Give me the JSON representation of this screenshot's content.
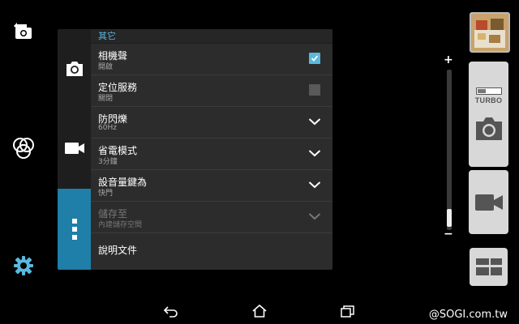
{
  "left_rail": {
    "icons": [
      "switch-camera-icon",
      "effects-icon",
      "settings-icon"
    ]
  },
  "panel": {
    "section_header": "其它",
    "tabs": [
      "camera-tab-icon",
      "video-tab-icon",
      "more-tab-icon"
    ],
    "rows": [
      {
        "title": "相機聲",
        "subtitle": "開啟",
        "control": "checkbox-checked"
      },
      {
        "title": "定位服務",
        "subtitle": "關閉",
        "control": "checkbox-unchecked"
      },
      {
        "title": "防閃爍",
        "subtitle": "60Hz",
        "control": "chevron-down"
      },
      {
        "title": "省電模式",
        "subtitle": "3分鐘",
        "control": "chevron-down"
      },
      {
        "title": "設音量鍵為",
        "subtitle": "快門",
        "control": "chevron-down"
      },
      {
        "title": "儲存至",
        "subtitle": "內建儲存空間",
        "control": "chevron-down",
        "disabled": true
      },
      {
        "title": "說明文件"
      }
    ]
  },
  "zoom": {
    "plus": "+",
    "minus": "−",
    "level": 0.05
  },
  "right_controls": {
    "turbo_label": "TURBO",
    "buttons": [
      "gallery-thumbnail",
      "turbo-shutter-button",
      "video-record-button",
      "mode-grid-button"
    ]
  },
  "navbar": {
    "icons": [
      "back-icon",
      "home-icon",
      "recents-icon"
    ]
  },
  "watermark": "@SOGI.com.tw",
  "colors": {
    "accent": "#5ab8dd",
    "active_tab": "#1f7fa8",
    "panel": "#2c2c2c"
  }
}
